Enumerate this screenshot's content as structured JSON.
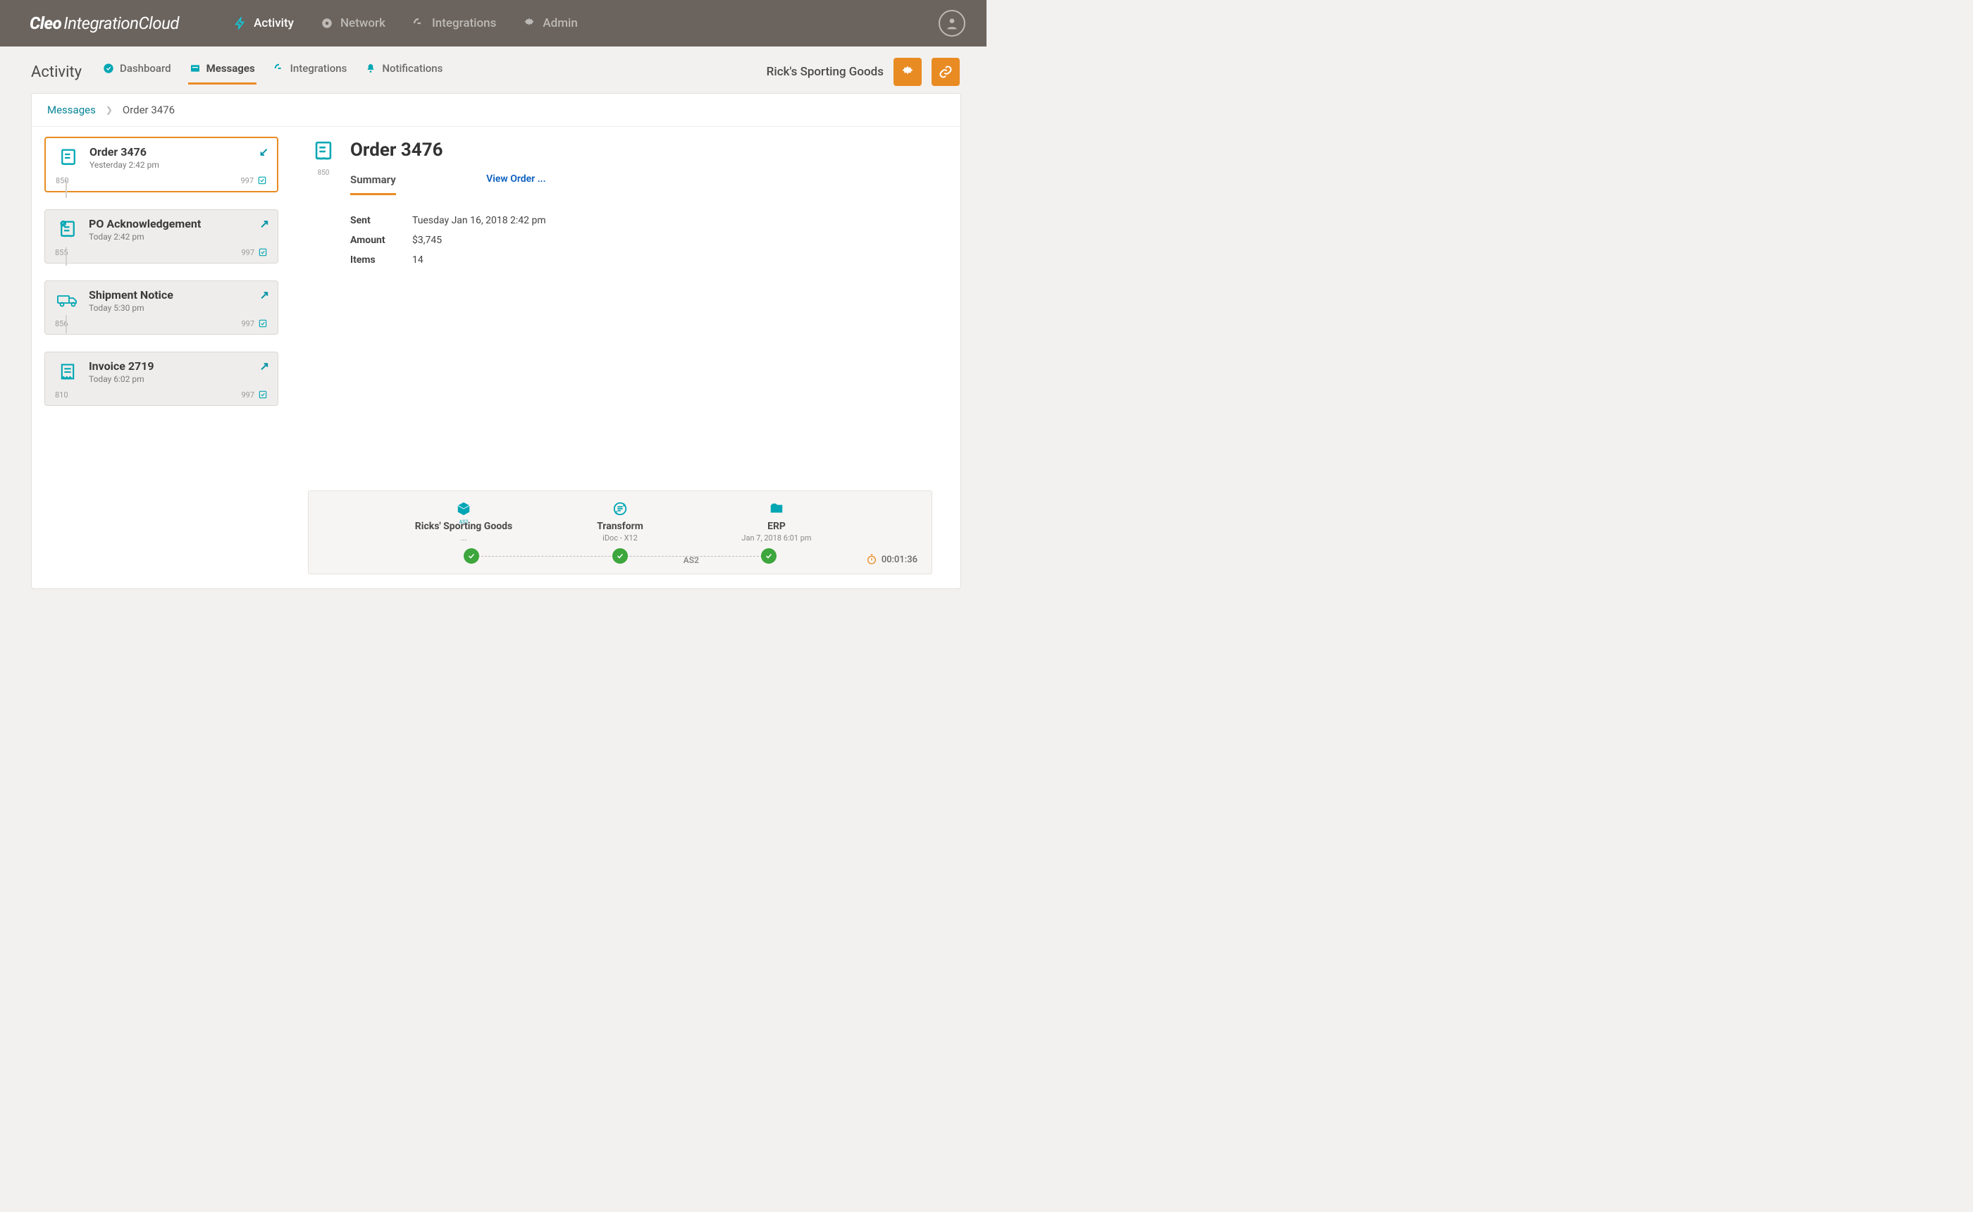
{
  "brand": {
    "primary": "Cleo",
    "secondary": "IntegrationCloud"
  },
  "nav": {
    "activity": "Activity",
    "network": "Network",
    "integrations": "Integrations",
    "admin": "Admin"
  },
  "subnav": {
    "title": "Activity",
    "tabs": {
      "dashboard": "Dashboard",
      "messages": "Messages",
      "integrations": "Integrations",
      "notifications": "Notifications"
    },
    "company": "Rick's Sporting Goods"
  },
  "breadcrumb": {
    "root": "Messages",
    "current": "Order 3476"
  },
  "messages": [
    {
      "title": "Order 3476",
      "sub": "Yesterday 2:42 pm",
      "codeL": "850",
      "codeR": "997",
      "dir": "in"
    },
    {
      "title": "PO Acknowledgement",
      "sub": "Today 2:42 pm",
      "codeL": "855",
      "codeR": "997",
      "dir": "out"
    },
    {
      "title": "Shipment Notice",
      "sub": "Today 5:30 pm",
      "codeL": "856",
      "codeR": "997",
      "dir": "out"
    },
    {
      "title": "Invoice 2719",
      "sub": "Today 6:02 pm",
      "codeL": "810",
      "codeR": "997",
      "dir": "out"
    }
  ],
  "detail": {
    "code": "850",
    "title": "Order 3476",
    "tab": "Summary",
    "view_order": "View Order ...",
    "rows": {
      "sent_label": "Sent",
      "sent_value": "Tuesday Jan 16, 2018 2:42 pm",
      "amount_label": "Amount",
      "amount_value": "$3,745",
      "items_label": "Items",
      "items_value": "14"
    }
  },
  "flow": {
    "steps": [
      {
        "title": "Ricks' Sporting Goods",
        "sub": "...",
        "iconsub": "AS2"
      },
      {
        "title": "Transform",
        "sub": "iDoc - X12"
      },
      {
        "title": "ERP",
        "sub": "Jan 7, 2018  6:01 pm"
      }
    ],
    "protocol": "AS2",
    "timer": "00:01:36"
  }
}
